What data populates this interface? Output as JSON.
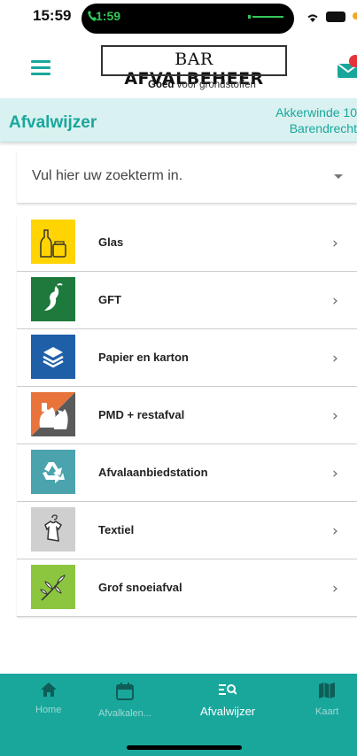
{
  "status_bar": {
    "time": "15:59",
    "call_time": "1:59"
  },
  "header": {
    "logo_prefix": "BAR",
    "logo_main": "AFVALBEHEER",
    "tagline_bold": "Goed",
    "tagline_rest": " voor grondstoffen"
  },
  "subheader": {
    "title": "Afvalwijzer",
    "address_line1": "Akkerwinde 10",
    "address_line2": "Barendrecht"
  },
  "search": {
    "placeholder": "Vul hier uw zoekterm in."
  },
  "categories": [
    {
      "label": "Glas",
      "icon": "glass-icon",
      "color": "#ffd400"
    },
    {
      "label": "GFT",
      "icon": "apple-core-icon",
      "color": "#1e7a3c"
    },
    {
      "label": "Papier en karton",
      "icon": "paper-stack-icon",
      "color": "#1f5fa8"
    },
    {
      "label": "PMD + restafval",
      "icon": "trash-bags-icon",
      "color": "#e8743b"
    },
    {
      "label": "Afvalaanbiedstation",
      "icon": "recycle-icon",
      "color": "#4aa3ad"
    },
    {
      "label": "Textiel",
      "icon": "shirt-icon",
      "color": "#cfcfcf"
    },
    {
      "label": "Grof snoeiafval",
      "icon": "branch-icon",
      "color": "#8cc63f"
    }
  ],
  "nav": {
    "home": "Home",
    "calendar": "Afvalkalen...",
    "afvalwijzer": "Afvalwijzer",
    "map": "Kaart"
  },
  "colors": {
    "accent": "#19a79c",
    "subheader_bg": "#d9f1f0"
  }
}
